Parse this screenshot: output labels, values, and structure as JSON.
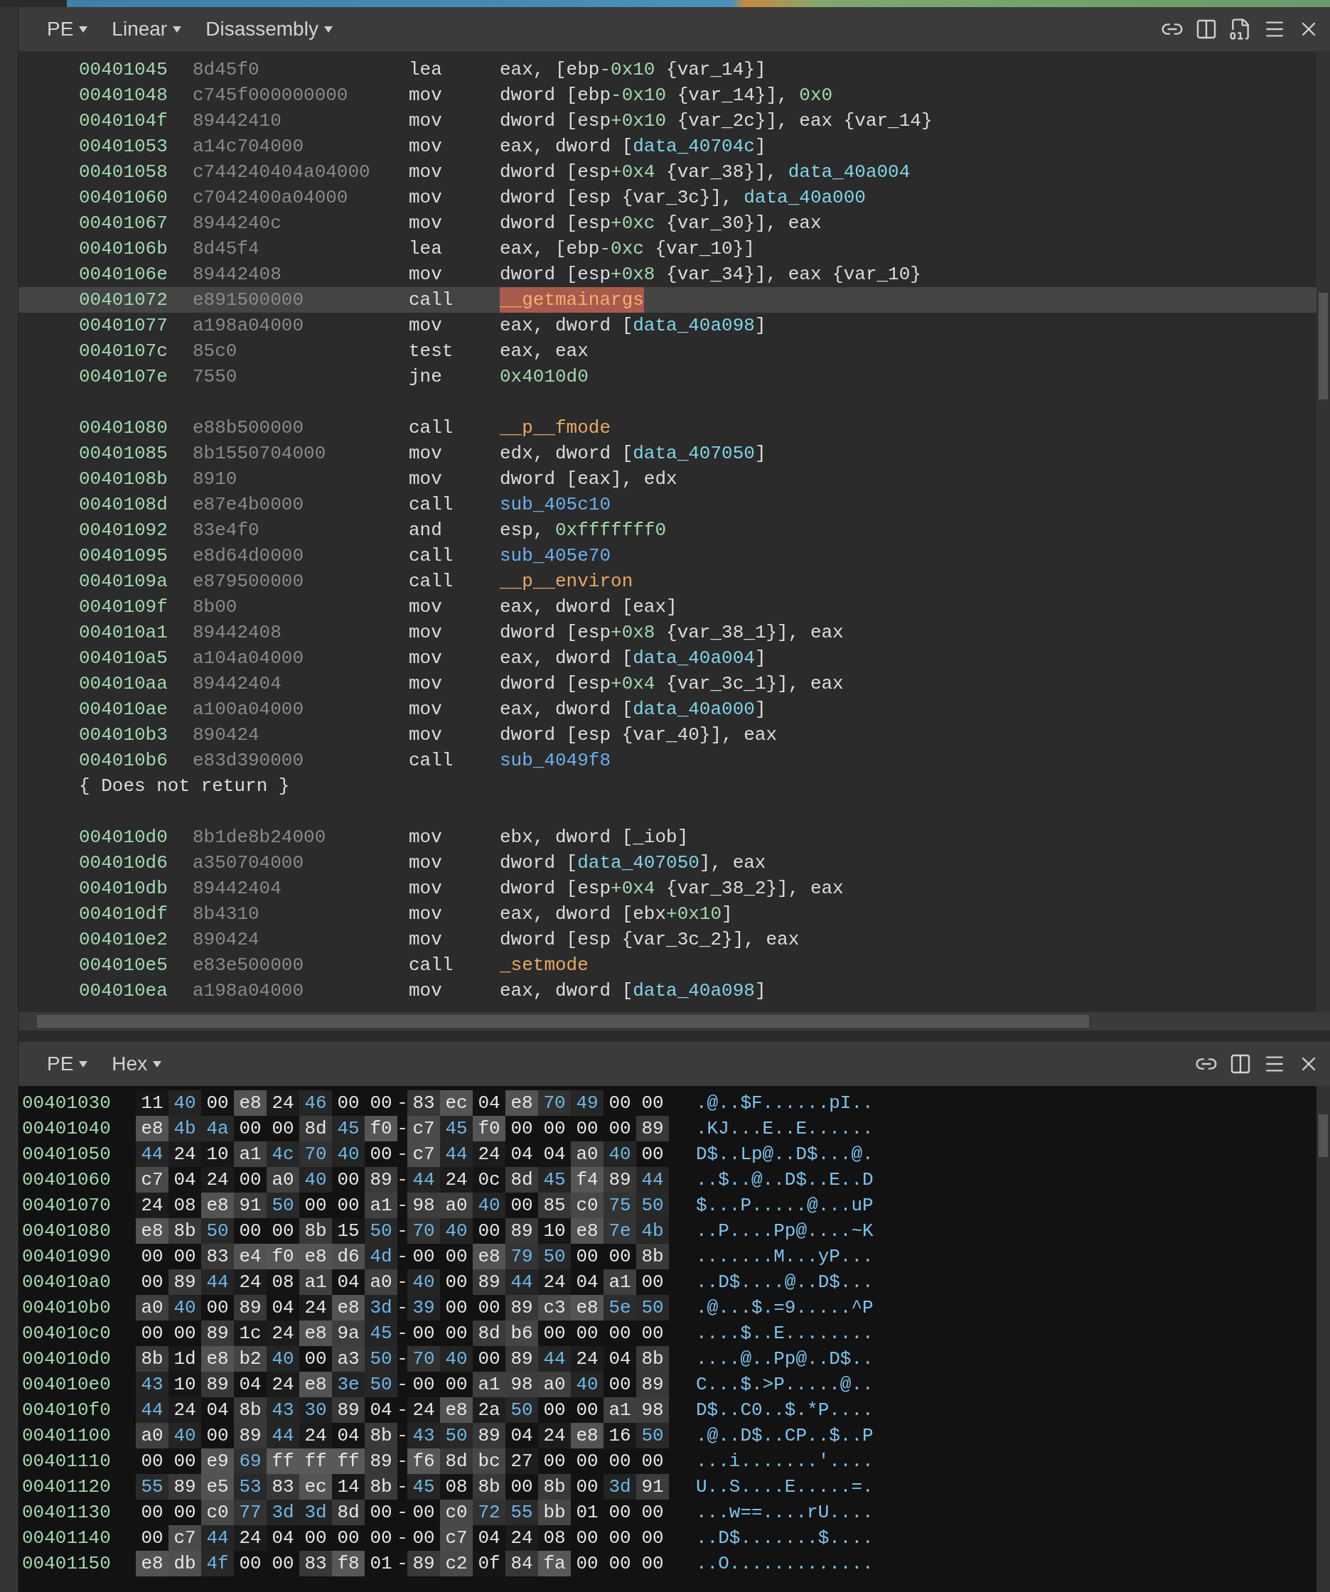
{
  "disassembly_panel": {
    "header": {
      "menus": [
        {
          "label": "PE"
        },
        {
          "label": "Linear"
        },
        {
          "label": "Disassembly"
        }
      ]
    },
    "rows": [
      {
        "kind": "insn",
        "selected": false,
        "address": "00401045",
        "bytes": "8d45f0",
        "mnemonic": "lea",
        "operands": [
          {
            "kind": "plain",
            "text": "eax, [ebp"
          },
          {
            "kind": "number",
            "text": "-0x10"
          },
          {
            "kind": "plain",
            "text": " {var_14}]"
          }
        ]
      },
      {
        "kind": "insn",
        "selected": false,
        "address": "00401048",
        "bytes": "c745f000000000",
        "mnemonic": "mov",
        "operands": [
          {
            "kind": "plain",
            "text": "dword [ebp"
          },
          {
            "kind": "number",
            "text": "-0x10"
          },
          {
            "kind": "plain",
            "text": " {var_14}], "
          },
          {
            "kind": "number",
            "text": "0x0"
          }
        ]
      },
      {
        "kind": "insn",
        "selected": false,
        "address": "0040104f",
        "bytes": "89442410",
        "mnemonic": "mov",
        "operands": [
          {
            "kind": "plain",
            "text": "dword [esp"
          },
          {
            "kind": "number",
            "text": "+0x10"
          },
          {
            "kind": "plain",
            "text": " {var_2c}], eax {var_14}"
          }
        ]
      },
      {
        "kind": "insn",
        "selected": false,
        "address": "00401053",
        "bytes": "a14c704000",
        "mnemonic": "mov",
        "operands": [
          {
            "kind": "plain",
            "text": "eax, dword ["
          },
          {
            "kind": "data",
            "text": "data_40704c"
          },
          {
            "kind": "plain",
            "text": "]"
          }
        ]
      },
      {
        "kind": "insn",
        "selected": false,
        "address": "00401058",
        "bytes": "c744240404a04000",
        "mnemonic": "mov",
        "operands": [
          {
            "kind": "plain",
            "text": "dword [esp"
          },
          {
            "kind": "number",
            "text": "+0x4"
          },
          {
            "kind": "plain",
            "text": " {var_38}], "
          },
          {
            "kind": "data",
            "text": "data_40a004"
          }
        ]
      },
      {
        "kind": "insn",
        "selected": false,
        "address": "00401060",
        "bytes": "c7042400a04000",
        "mnemonic": "mov",
        "operands": [
          {
            "kind": "plain",
            "text": "dword [esp {var_3c}], "
          },
          {
            "kind": "data",
            "text": "data_40a000"
          }
        ]
      },
      {
        "kind": "insn",
        "selected": false,
        "address": "00401067",
        "bytes": "8944240c",
        "mnemonic": "mov",
        "operands": [
          {
            "kind": "plain",
            "text": "dword [esp"
          },
          {
            "kind": "number",
            "text": "+0xc"
          },
          {
            "kind": "plain",
            "text": " {var_30}], eax"
          }
        ]
      },
      {
        "kind": "insn",
        "selected": false,
        "address": "0040106b",
        "bytes": "8d45f4",
        "mnemonic": "lea",
        "operands": [
          {
            "kind": "plain",
            "text": "eax, [ebp"
          },
          {
            "kind": "number",
            "text": "-0xc"
          },
          {
            "kind": "plain",
            "text": " {var_10}]"
          }
        ]
      },
      {
        "kind": "insn",
        "selected": false,
        "address": "0040106e",
        "bytes": "89442408",
        "mnemonic": "mov",
        "operands": [
          {
            "kind": "plain",
            "text": "dword [esp"
          },
          {
            "kind": "number",
            "text": "+0x8"
          },
          {
            "kind": "plain",
            "text": " {var_34}], eax {var_10}"
          }
        ]
      },
      {
        "kind": "insn",
        "selected": true,
        "address": "00401072",
        "bytes": "e891500000",
        "mnemonic": "call",
        "operands": [
          {
            "kind": "highlight",
            "text": "__getmainargs"
          }
        ]
      },
      {
        "kind": "insn",
        "selected": false,
        "address": "00401077",
        "bytes": "a198a04000",
        "mnemonic": "mov",
        "operands": [
          {
            "kind": "plain",
            "text": "eax, dword ["
          },
          {
            "kind": "data",
            "text": "data_40a098"
          },
          {
            "kind": "plain",
            "text": "]"
          }
        ]
      },
      {
        "kind": "insn",
        "selected": false,
        "address": "0040107c",
        "bytes": "85c0",
        "mnemonic": "test",
        "operands": [
          {
            "kind": "plain",
            "text": "eax, eax"
          }
        ]
      },
      {
        "kind": "insn",
        "selected": false,
        "address": "0040107e",
        "bytes": "7550",
        "mnemonic": "jne",
        "operands": [
          {
            "kind": "number",
            "text": "0x4010d0"
          }
        ]
      },
      {
        "kind": "blank"
      },
      {
        "kind": "insn",
        "selected": false,
        "address": "00401080",
        "bytes": "e88b500000",
        "mnemonic": "call",
        "operands": [
          {
            "kind": "import",
            "text": "__p__fmode"
          }
        ]
      },
      {
        "kind": "insn",
        "selected": false,
        "address": "00401085",
        "bytes": "8b1550704000",
        "mnemonic": "mov",
        "operands": [
          {
            "kind": "plain",
            "text": "edx, dword ["
          },
          {
            "kind": "data",
            "text": "data_407050"
          },
          {
            "kind": "plain",
            "text": "]"
          }
        ]
      },
      {
        "kind": "insn",
        "selected": false,
        "address": "0040108b",
        "bytes": "8910",
        "mnemonic": "mov",
        "operands": [
          {
            "kind": "plain",
            "text": "dword [eax], edx"
          }
        ]
      },
      {
        "kind": "insn",
        "selected": false,
        "address": "0040108d",
        "bytes": "e87e4b0000",
        "mnemonic": "call",
        "operands": [
          {
            "kind": "sub",
            "text": "sub_405c10"
          }
        ]
      },
      {
        "kind": "insn",
        "selected": false,
        "address": "00401092",
        "bytes": "83e4f0",
        "mnemonic": "and",
        "operands": [
          {
            "kind": "plain",
            "text": "esp, "
          },
          {
            "kind": "number",
            "text": "0xfffffff0"
          }
        ]
      },
      {
        "kind": "insn",
        "selected": false,
        "address": "00401095",
        "bytes": "e8d64d0000",
        "mnemonic": "call",
        "operands": [
          {
            "kind": "sub",
            "text": "sub_405e70"
          }
        ]
      },
      {
        "kind": "insn",
        "selected": false,
        "address": "0040109a",
        "bytes": "e879500000",
        "mnemonic": "call",
        "operands": [
          {
            "kind": "import",
            "text": "__p__environ"
          }
        ]
      },
      {
        "kind": "insn",
        "selected": false,
        "address": "0040109f",
        "bytes": "8b00",
        "mnemonic": "mov",
        "operands": [
          {
            "kind": "plain",
            "text": "eax, dword [eax]"
          }
        ]
      },
      {
        "kind": "insn",
        "selected": false,
        "address": "004010a1",
        "bytes": "89442408",
        "mnemonic": "mov",
        "operands": [
          {
            "kind": "plain",
            "text": "dword [esp"
          },
          {
            "kind": "number",
            "text": "+0x8"
          },
          {
            "kind": "plain",
            "text": " {var_38_1}], eax"
          }
        ]
      },
      {
        "kind": "insn",
        "selected": false,
        "address": "004010a5",
        "bytes": "a104a04000",
        "mnemonic": "mov",
        "operands": [
          {
            "kind": "plain",
            "text": "eax, dword ["
          },
          {
            "kind": "data",
            "text": "data_40a004"
          },
          {
            "kind": "plain",
            "text": "]"
          }
        ]
      },
      {
        "kind": "insn",
        "selected": false,
        "address": "004010aa",
        "bytes": "89442404",
        "mnemonic": "mov",
        "operands": [
          {
            "kind": "plain",
            "text": "dword [esp"
          },
          {
            "kind": "number",
            "text": "+0x4"
          },
          {
            "kind": "plain",
            "text": " {var_3c_1}], eax"
          }
        ]
      },
      {
        "kind": "insn",
        "selected": false,
        "address": "004010ae",
        "bytes": "a100a04000",
        "mnemonic": "mov",
        "operands": [
          {
            "kind": "plain",
            "text": "eax, dword ["
          },
          {
            "kind": "data",
            "text": "data_40a000"
          },
          {
            "kind": "plain",
            "text": "]"
          }
        ]
      },
      {
        "kind": "insn",
        "selected": false,
        "address": "004010b3",
        "bytes": "890424",
        "mnemonic": "mov",
        "operands": [
          {
            "kind": "plain",
            "text": "dword [esp {var_40}], eax"
          }
        ]
      },
      {
        "kind": "insn",
        "selected": false,
        "address": "004010b6",
        "bytes": "e83d390000",
        "mnemonic": "call",
        "operands": [
          {
            "kind": "sub",
            "text": "sub_4049f8"
          }
        ]
      },
      {
        "kind": "note",
        "text": "{ Does not return }"
      },
      {
        "kind": "blank"
      },
      {
        "kind": "insn",
        "selected": false,
        "address": "004010d0",
        "bytes": "8b1de8b24000",
        "mnemonic": "mov",
        "operands": [
          {
            "kind": "plain",
            "text": "ebx, dword [_iob]"
          }
        ]
      },
      {
        "kind": "insn",
        "selected": false,
        "address": "004010d6",
        "bytes": "a350704000",
        "mnemonic": "mov",
        "operands": [
          {
            "kind": "plain",
            "text": "dword ["
          },
          {
            "kind": "data",
            "text": "data_407050"
          },
          {
            "kind": "plain",
            "text": "], eax"
          }
        ]
      },
      {
        "kind": "insn",
        "selected": false,
        "address": "004010db",
        "bytes": "89442404",
        "mnemonic": "mov",
        "operands": [
          {
            "kind": "plain",
            "text": "dword [esp"
          },
          {
            "kind": "number",
            "text": "+0x4"
          },
          {
            "kind": "plain",
            "text": " {var_38_2}], eax"
          }
        ]
      },
      {
        "kind": "insn",
        "selected": false,
        "address": "004010df",
        "bytes": "8b4310",
        "mnemonic": "mov",
        "operands": [
          {
            "kind": "plain",
            "text": "eax, dword [ebx"
          },
          {
            "kind": "number",
            "text": "+0x10"
          },
          {
            "kind": "plain",
            "text": "]"
          }
        ]
      },
      {
        "kind": "insn",
        "selected": false,
        "address": "004010e2",
        "bytes": "890424",
        "mnemonic": "mov",
        "operands": [
          {
            "kind": "plain",
            "text": "dword [esp {var_3c_2}], eax"
          }
        ]
      },
      {
        "kind": "insn",
        "selected": false,
        "address": "004010e5",
        "bytes": "e83e500000",
        "mnemonic": "call",
        "operands": [
          {
            "kind": "import",
            "text": "_setmode"
          }
        ]
      },
      {
        "kind": "insn",
        "selected": false,
        "address": "004010ea",
        "bytes": "a198a04000",
        "mnemonic": "mov",
        "operands": [
          {
            "kind": "plain",
            "text": "eax, dword ["
          },
          {
            "kind": "data",
            "text": "data_40a098"
          },
          {
            "kind": "plain",
            "text": "]"
          }
        ]
      }
    ]
  },
  "hex_panel": {
    "header": {
      "menus": [
        {
          "label": "PE"
        },
        {
          "label": "Hex"
        }
      ]
    },
    "rows": [
      {
        "address": "00401030",
        "bytes": "11 40 00 e8 24 46 00 00-83 ec 04 e8 70 49 00 00",
        "ascii": ".@..$F......pI.."
      },
      {
        "address": "00401040",
        "bytes": "e8 4b 4a 00 00 8d 45 f0-c7 45 f0 00 00 00 00 89",
        "ascii": ".KJ...E..E......"
      },
      {
        "address": "00401050",
        "bytes": "44 24 10 a1 4c 70 40 00-c7 44 24 04 04 a0 40 00",
        "ascii": "D$..Lp@..D$...@."
      },
      {
        "address": "00401060",
        "bytes": "c7 04 24 00 a0 40 00 89-44 24 0c 8d 45 f4 89 44",
        "ascii": "..$..@..D$..E..D"
      },
      {
        "address": "00401070",
        "bytes": "24 08 e8 91 50 00 00 a1-98 a0 40 00 85 c0 75 50",
        "ascii": "$...P.....@...uP"
      },
      {
        "address": "00401080",
        "bytes": "e8 8b 50 00 00 8b 15 50-70 40 00 89 10 e8 7e 4b",
        "ascii": "..P....Pp@....~K"
      },
      {
        "address": "00401090",
        "bytes": "00 00 83 e4 f0 e8 d6 4d-00 00 e8 79 50 00 00 8b",
        "ascii": ".......M...yP..."
      },
      {
        "address": "004010a0",
        "bytes": "00 89 44 24 08 a1 04 a0-40 00 89 44 24 04 a1 00",
        "ascii": "..D$....@..D$..."
      },
      {
        "address": "004010b0",
        "bytes": "a0 40 00 89 04 24 e8 3d-39 00 00 89 c3 e8 5e 50",
        "ascii": ".@...$.=9.....^P"
      },
      {
        "address": "004010c0",
        "bytes": "00 00 89 1c 24 e8 9a 45-00 00 8d b6 00 00 00 00",
        "ascii": "....$..E........"
      },
      {
        "address": "004010d0",
        "bytes": "8b 1d e8 b2 40 00 a3 50-70 40 00 89 44 24 04 8b",
        "ascii": "....@..Pp@..D$.."
      },
      {
        "address": "004010e0",
        "bytes": "43 10 89 04 24 e8 3e 50-00 00 a1 98 a0 40 00 89",
        "ascii": "C...$.>P.....@.."
      },
      {
        "address": "004010f0",
        "bytes": "44 24 04 8b 43 30 89 04-24 e8 2a 50 00 00 a1 98",
        "ascii": "D$..C0..$.*P...."
      },
      {
        "address": "00401100",
        "bytes": "a0 40 00 89 44 24 04 8b-43 50 89 04 24 e8 16 50",
        "ascii": ".@..D$..CP..$..P"
      },
      {
        "address": "00401110",
        "bytes": "00 00 e9 69 ff ff ff 89-f6 8d bc 27 00 00 00 00",
        "ascii": "...i.......'...."
      },
      {
        "address": "00401120",
        "bytes": "55 89 e5 53 83 ec 14 8b-45 08 8b 00 8b 00 3d 91",
        "ascii": "U..S....E.....=."
      },
      {
        "address": "00401130",
        "bytes": "00 00 c0 77 3d 3d 8d 00-00 c0 72 55 bb 01 00 00",
        "ascii": "...w==....rU...."
      },
      {
        "address": "00401140",
        "bytes": "00 c7 44 24 04 00 00 00-00 c7 04 24 08 00 00 00",
        "ascii": "..D$.......$...."
      },
      {
        "address": "00401150",
        "bytes": "e8 db 4f 00 00 83 f8 01-89 c2 0f 84 fa 00 00 00",
        "ascii": "..O............."
      }
    ]
  }
}
